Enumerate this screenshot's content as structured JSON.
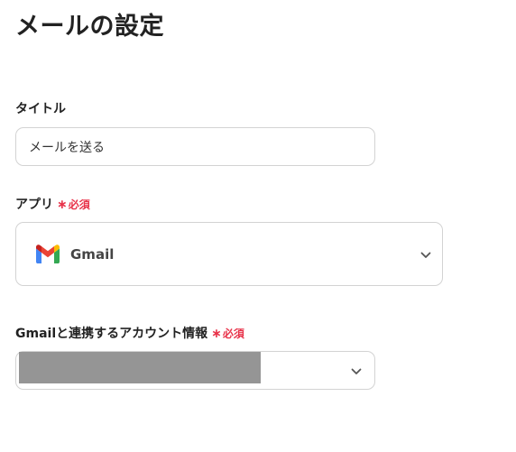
{
  "page": {
    "title": "メールの設定"
  },
  "fields": {
    "title": {
      "label": "タイトル",
      "value": "メールを送る"
    },
    "app": {
      "label": "アプリ",
      "required_mark": "∗",
      "required_text": "必須",
      "selected": "Gmail",
      "icon": "gmail-logo"
    },
    "account": {
      "label": "Gmailと連携するアカウント情報",
      "required_mark": "∗",
      "required_text": "必須",
      "selected_redacted": true
    }
  },
  "colors": {
    "required": "#e8334a",
    "border": "#d3d3d3",
    "redaction": "#959595"
  }
}
